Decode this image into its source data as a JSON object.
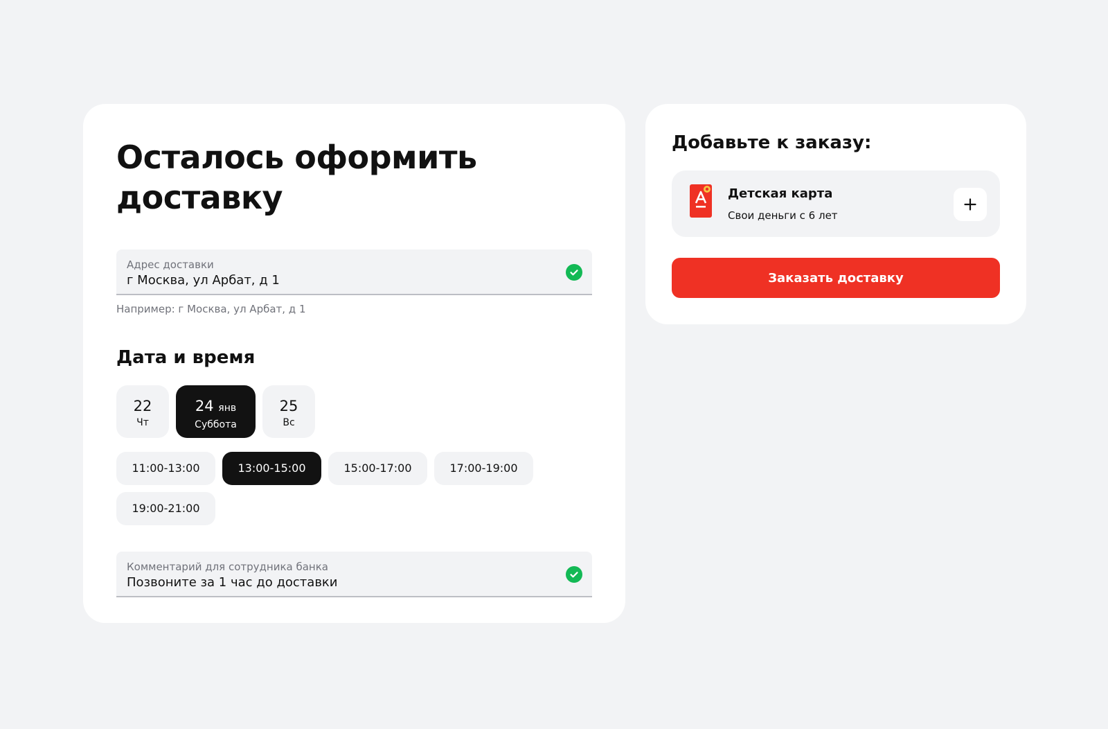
{
  "page": {
    "title": "Осталось оформить доставку"
  },
  "address": {
    "label": "Адрес доставки",
    "value": "г Москва, ул Арбат, д 1",
    "hint": "Например: г Москва, ул Арбат, д 1"
  },
  "schedule": {
    "title": "Дата и время",
    "dates": [
      {
        "day": "22",
        "month": "",
        "weekday": "Чт",
        "selected": false
      },
      {
        "day": "24",
        "month": "янв",
        "weekday": "Суббота",
        "selected": true
      },
      {
        "day": "25",
        "month": "",
        "weekday": "Вс",
        "selected": false
      }
    ],
    "times": [
      {
        "label": "11:00-13:00",
        "selected": false
      },
      {
        "label": "13:00-15:00",
        "selected": true
      },
      {
        "label": "15:00-17:00",
        "selected": false
      },
      {
        "label": "17:00-19:00",
        "selected": false
      },
      {
        "label": "19:00-21:00",
        "selected": false
      }
    ]
  },
  "comment": {
    "label": "Комментарий для сотрудника банка",
    "value": "Позвоните за 1 час до доставки"
  },
  "addons": {
    "title": "Добавьте к заказу:",
    "items": [
      {
        "name": "Детская карта",
        "description": "Свои деньги с 6 лет",
        "icon": "kids-card-icon"
      }
    ]
  },
  "actions": {
    "order_label": "Заказать доставку"
  },
  "colors": {
    "background": "#f2f3f5",
    "accent": "#ef3124",
    "success": "#13b955",
    "selected": "#121212"
  }
}
